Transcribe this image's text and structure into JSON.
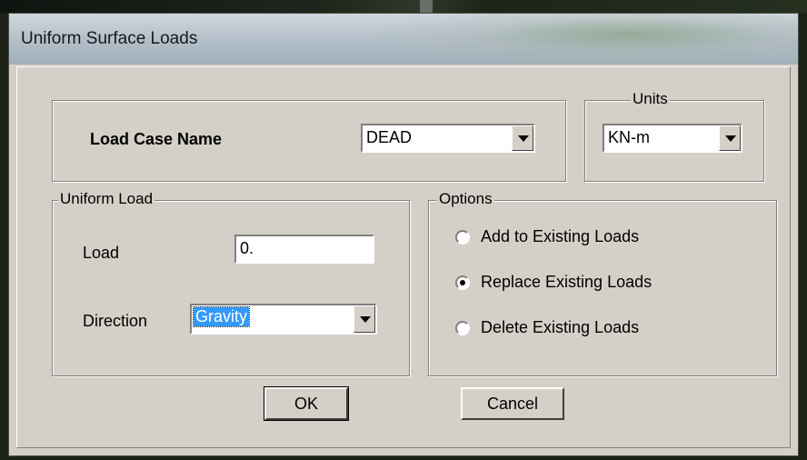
{
  "dialog": {
    "title": "Uniform Surface Loads",
    "load_case": {
      "label": "Load Case Name",
      "value": "DEAD"
    },
    "units": {
      "legend": "Units",
      "value": "KN-m"
    },
    "uniform_load": {
      "legend": "Uniform Load",
      "load_label": "Load",
      "load_value": "0.",
      "direction_label": "Direction",
      "direction_value": "Gravity"
    },
    "options": {
      "legend": "Options",
      "items": [
        {
          "label": "Add to Existing Loads",
          "selected": false
        },
        {
          "label": "Replace Existing Loads",
          "selected": true
        },
        {
          "label": "Delete Existing Loads",
          "selected": false
        }
      ]
    },
    "buttons": {
      "ok": "OK",
      "cancel": "Cancel"
    }
  }
}
